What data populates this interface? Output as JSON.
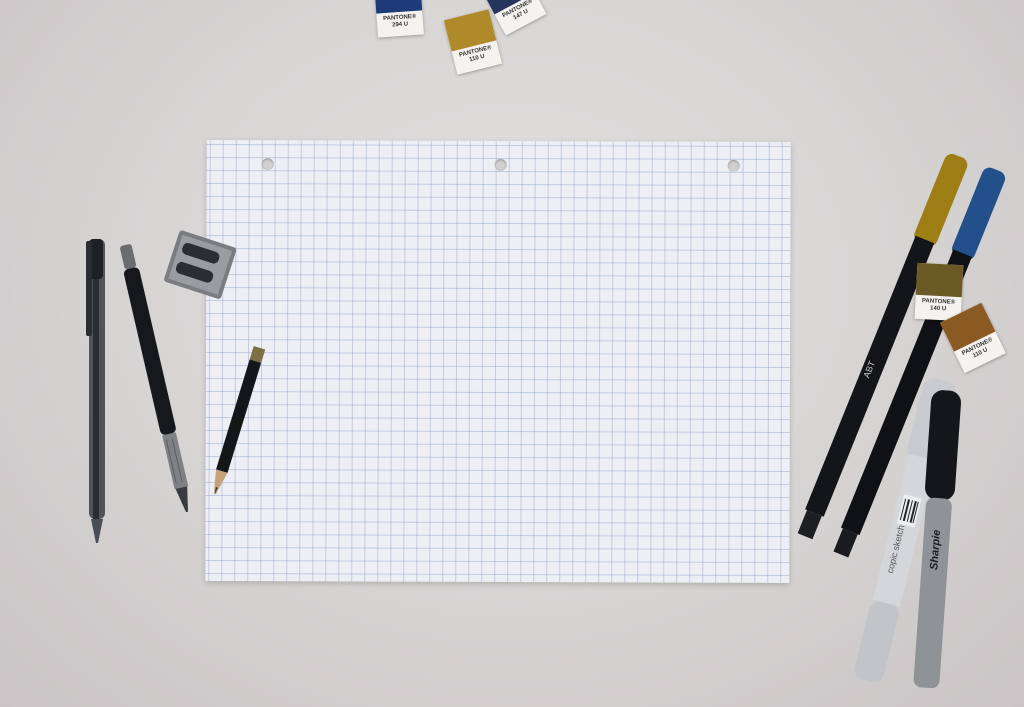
{
  "image": {
    "description_colors": {
      "background": "#d9d6d6",
      "paper": "#eeeff4",
      "grid": "#8ca0c8"
    }
  },
  "swatches": [
    {
      "brand": "PANTONE®",
      "code": "294 U",
      "color": "#1f3a78"
    },
    {
      "brand": "PANTONE®",
      "code": "110 U",
      "color": "#b08a2a"
    },
    {
      "brand": "PANTONE®",
      "code": "147 U",
      "color": "#25355c"
    },
    {
      "brand": "PANTONE®",
      "code": "140 U",
      "color": "#6b5a26"
    },
    {
      "brand": "PANTONE®",
      "code": "110 U",
      "color": "#8a5a22"
    }
  ],
  "markers": {
    "sharpie_label": "Sharpie",
    "copic_label": "copic sketch"
  }
}
